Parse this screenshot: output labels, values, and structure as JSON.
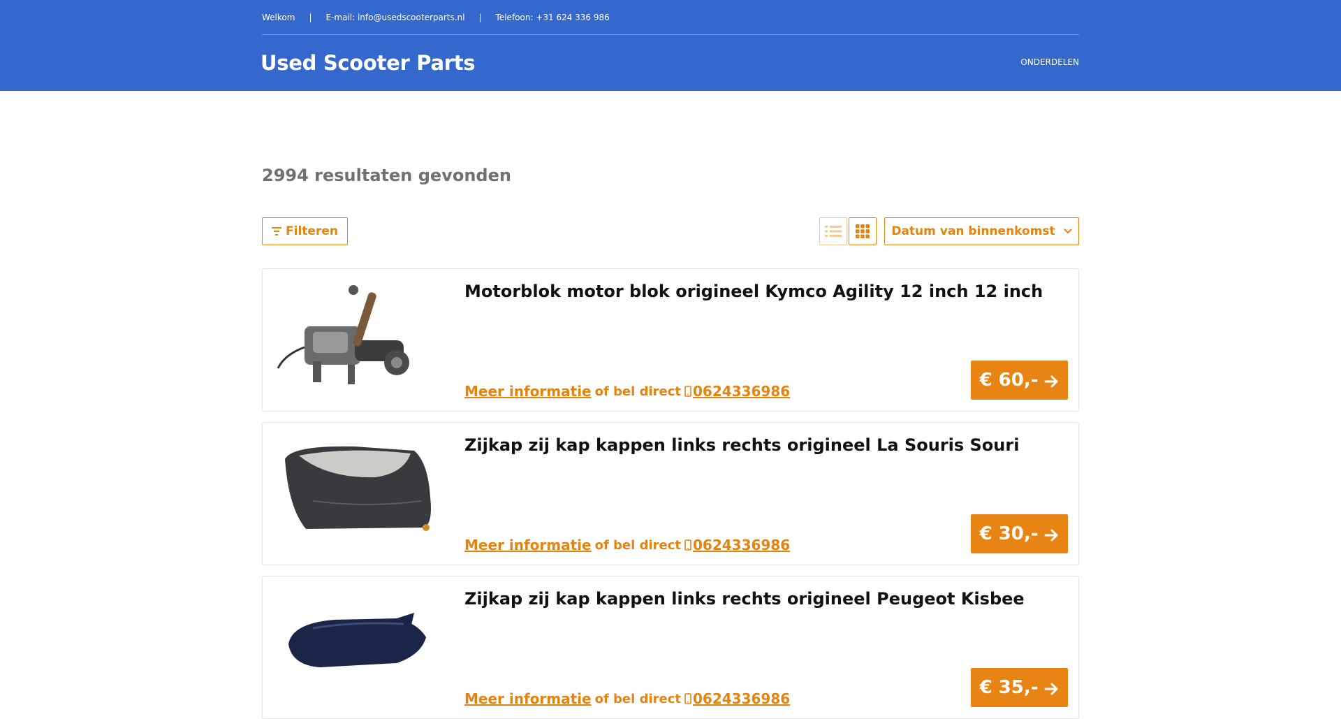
{
  "topbar": {
    "welcome": "Welkom",
    "email": "E-mail: info@usedscooterparts.nl",
    "phone": "Telefoon: +31 624 336 986",
    "separator": "|"
  },
  "brand": {
    "logo": "Used Scooter Parts"
  },
  "nav": {
    "onderdelen": "ONDERDELEN"
  },
  "results": {
    "count_text": "2994 resultaten gevonden"
  },
  "toolbar": {
    "filter_label": "Filteren",
    "sort_label": "Datum van binnenkomst"
  },
  "products": [
    {
      "title": "Motorblok motor blok origineel Kymco Agility 12 inch 12 inch",
      "more": "Meer informatie",
      "of": "of bel direct",
      "phone": "0624336986",
      "price": "€ 60,-"
    },
    {
      "title": "Zijkap zij kap kappen links rechts origineel La Souris Souri",
      "more": "Meer informatie",
      "of": "of bel direct",
      "phone": "0624336986",
      "price": "€ 30,-"
    },
    {
      "title": "Zijkap zij kap kappen links rechts origineel Peugeot Kisbee",
      "more": "Meer informatie",
      "of": "of bel direct",
      "phone": "0624336986",
      "price": "€ 35,-"
    }
  ],
  "colors": {
    "header": "#3468cd",
    "accent": "#e88414"
  }
}
